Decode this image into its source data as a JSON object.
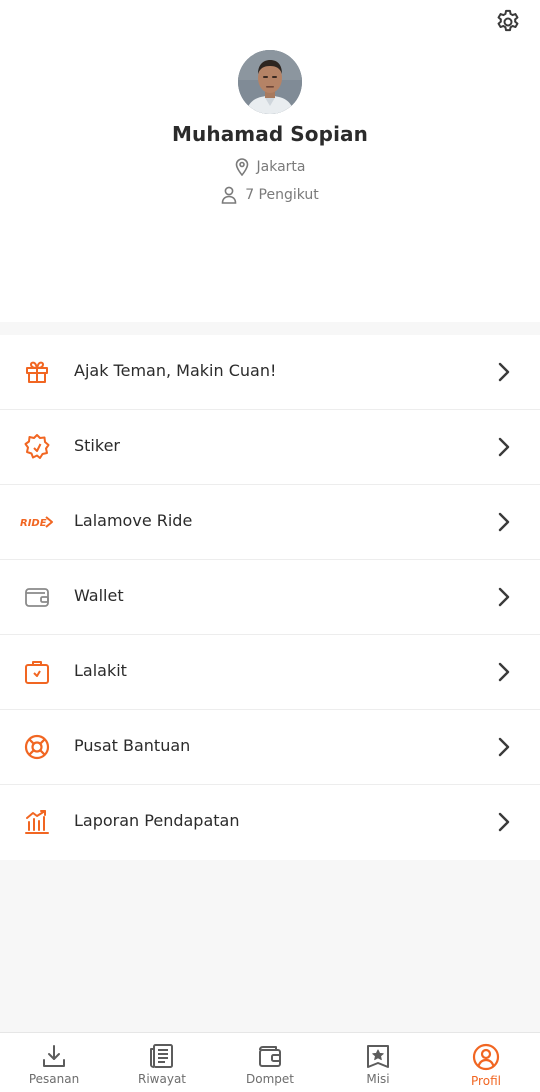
{
  "profile": {
    "name": "Muhamad Sopian",
    "city": "Jakarta",
    "followers": "7 Pengikut"
  },
  "menu": {
    "items": [
      {
        "label": "Ajak Teman, Makin Cuan!",
        "icon": "gift-icon"
      },
      {
        "label": "Stiker",
        "icon": "sticker-icon"
      },
      {
        "label": "Lalamove Ride",
        "icon": "ride-icon"
      },
      {
        "label": "Wallet",
        "icon": "wallet-icon"
      },
      {
        "label": "Lalakit",
        "icon": "lalakit-icon"
      },
      {
        "label": "Pusat Bantuan",
        "icon": "lifebuoy-icon"
      },
      {
        "label": "Laporan Pendapatan",
        "icon": "income-chart-icon"
      }
    ],
    "ride_icon_text": "RIDE"
  },
  "nav": {
    "items": [
      {
        "label": "Pesanan",
        "icon": "download-icon"
      },
      {
        "label": "Riwayat",
        "icon": "history-icon"
      },
      {
        "label": "Dompet",
        "icon": "wallet-icon"
      },
      {
        "label": "Misi",
        "icon": "mission-icon"
      },
      {
        "label": "Profil",
        "icon": "profile-icon",
        "active": true
      }
    ]
  },
  "colors": {
    "accent": "#f16622",
    "text": "#2b2b2b",
    "muted": "#7a7a7a",
    "background": "#f7f7f7"
  }
}
